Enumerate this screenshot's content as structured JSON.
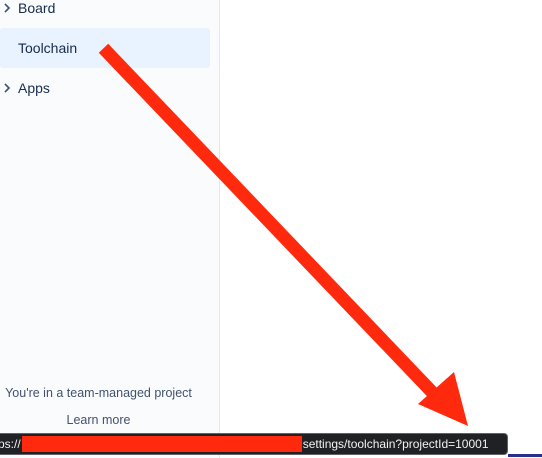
{
  "sidebar": {
    "items": [
      {
        "label": "Board",
        "icon": "chevron-right-icon"
      },
      {
        "label": "Toolchain",
        "selected": true
      },
      {
        "label": "Apps",
        "icon": "chevron-right-icon"
      }
    ],
    "footer_note": "You're in a team-managed project",
    "learn_more": "Learn more"
  },
  "statusbar": {
    "url_prefix": "ps://",
    "url_suffix": "settings/toolchain?projectId=10001"
  },
  "colors": {
    "selected_bg": "#e9f2ff",
    "annotation_arrow": "#ff2a0d",
    "redaction": "#ff2a0d"
  }
}
